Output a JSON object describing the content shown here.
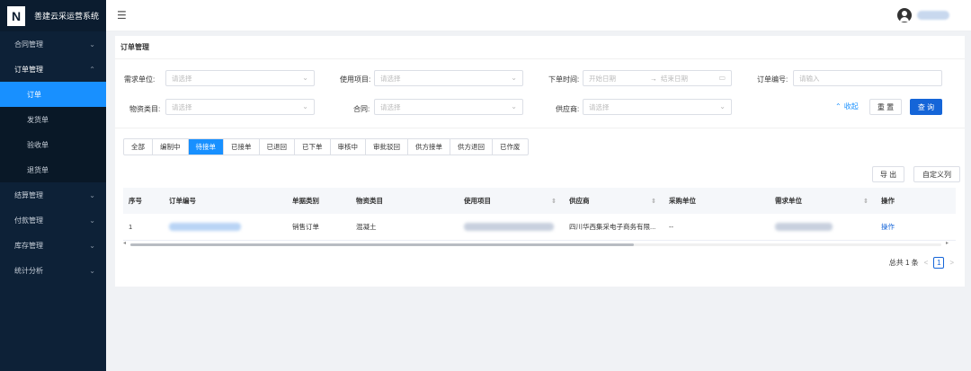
{
  "app": {
    "title": "善建云采运营系统",
    "logo_letter": "N"
  },
  "sidebar": {
    "items": [
      {
        "label": "合同管理",
        "chevron": "⌄"
      },
      {
        "label": "订单管理",
        "chevron": "⌃",
        "open": true,
        "children": [
          "订单",
          "发货单",
          "验收单",
          "退货单"
        ],
        "active_child": "订单"
      },
      {
        "label": "结算管理",
        "chevron": "⌄"
      },
      {
        "label": "付款管理",
        "chevron": "⌄"
      },
      {
        "label": "库存管理",
        "chevron": "⌄"
      },
      {
        "label": "统计分析",
        "chevron": "⌄"
      }
    ]
  },
  "header": {
    "menu_icon": "hamburger-icon",
    "avatar_icon": "user-avatar-icon"
  },
  "page": {
    "title": "订单管理"
  },
  "filters": {
    "demand_unit": {
      "label": "需求单位:",
      "placeholder": "请选择"
    },
    "project": {
      "label": "使用项目:",
      "placeholder": "请选择"
    },
    "order_time": {
      "label": "下单时间:",
      "start_placeholder": "开始日期",
      "separator": "→",
      "end_placeholder": "结束日期"
    },
    "order_no": {
      "label": "订单编号:",
      "placeholder": "请输入"
    },
    "material_type": {
      "label": "物资类目:",
      "placeholder": "请选择"
    },
    "contract": {
      "label": "合同:",
      "placeholder": "请选择"
    },
    "supplier": {
      "label": "供应商:",
      "placeholder": "请选择"
    }
  },
  "actions": {
    "collapse": "收起",
    "reset": "重 置",
    "search": "查 询"
  },
  "status_tabs": [
    "全部",
    "编制中",
    "待接单",
    "已接单",
    "已退回",
    "已下单",
    "审核中",
    "审批驳回",
    "供方接单",
    "供方退回",
    "已作废"
  ],
  "active_tab": "待接单",
  "toolbar": {
    "export": "导 出",
    "custom_columns": "自定义列"
  },
  "table": {
    "columns": [
      "序号",
      "订单编号",
      "单据类别",
      "物资类目",
      "使用项目",
      "供应商",
      "采购单位",
      "需求单位",
      "操作"
    ],
    "rows": [
      {
        "index": "1",
        "order_type": "销售订单",
        "material": "混凝土",
        "supplier": "四川华西集采电子商务有限...",
        "purchaser": "--",
        "action": "操作"
      }
    ]
  },
  "pagination": {
    "total": "总共 1 条",
    "current": "1",
    "prev": "<",
    "next": ">"
  }
}
